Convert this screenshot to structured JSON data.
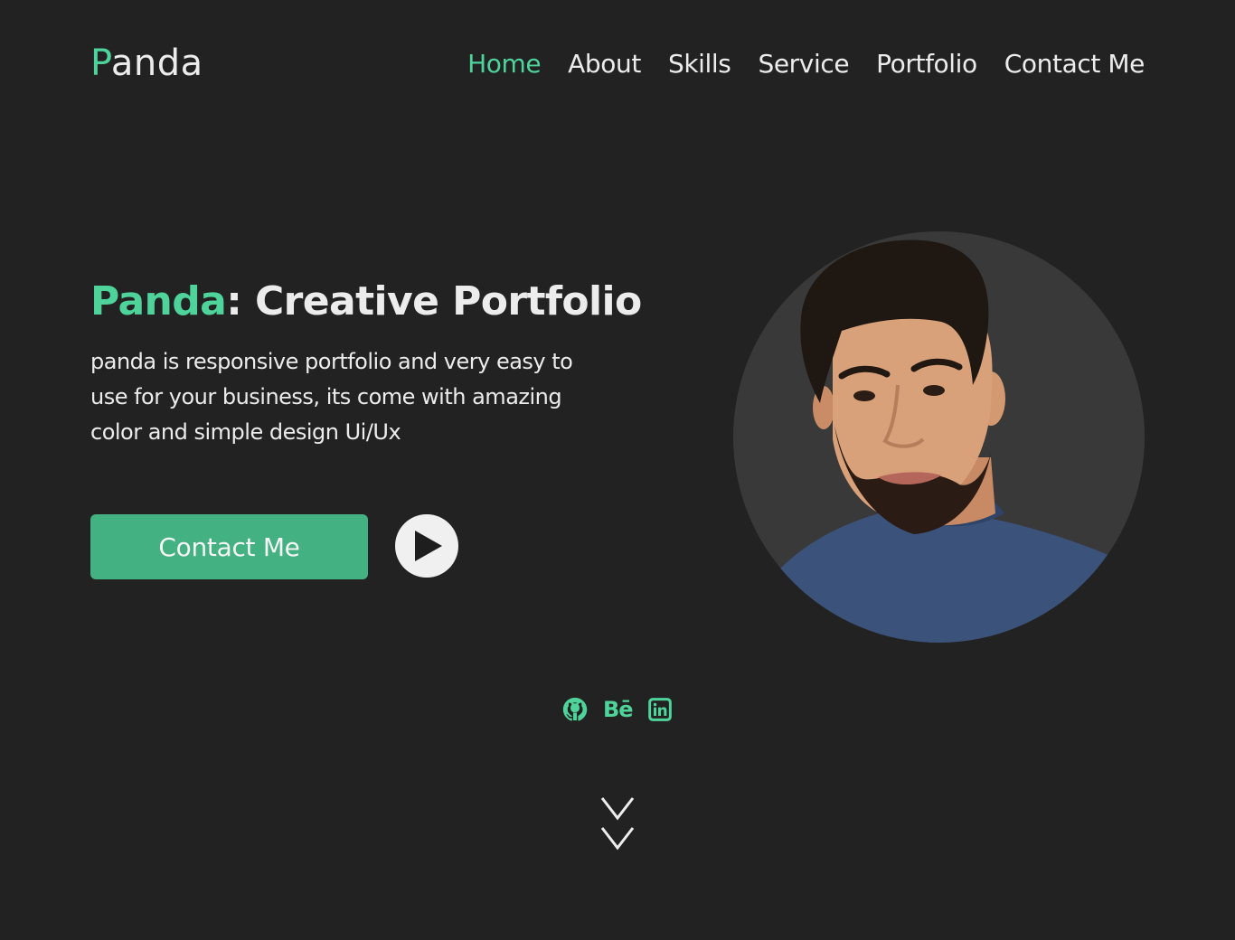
{
  "header": {
    "logo_first": "P",
    "logo_rest": "anda",
    "nav": [
      {
        "label": "Home",
        "active": true
      },
      {
        "label": "About",
        "active": false
      },
      {
        "label": "Skills",
        "active": false
      },
      {
        "label": "Service",
        "active": false
      },
      {
        "label": "Portfolio",
        "active": false
      },
      {
        "label": "Contact Me",
        "active": false
      }
    ]
  },
  "hero": {
    "title_accent": "Panda",
    "title_rest": ": Creative Portfolio",
    "description": "panda is responsive portfolio and very easy to use for your business, its come with amazing color and simple design Ui/Ux",
    "contact_button": "Contact Me",
    "play_icon": "play-icon"
  },
  "social": {
    "github_icon": "github-icon",
    "behance_text": "Bē",
    "linkedin_icon": "linkedin-icon"
  },
  "scroll_icon": "double-chevron-down-icon",
  "colors": {
    "background": "#222222",
    "accent": "#4ed39b",
    "button": "#43b182",
    "text": "#ececec",
    "portrait_bg": "#393939"
  }
}
